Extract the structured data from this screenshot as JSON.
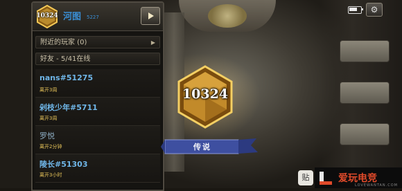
{
  "player": {
    "rank_number": "10324",
    "name": "河图",
    "tag": "5227"
  },
  "sections": {
    "nearby_players": "附近的玩家 (0)",
    "friends_header": "好友 - 5/41在线"
  },
  "friends": [
    {
      "name": "nans#51275",
      "status": "离开3周"
    },
    {
      "name": "剁枝少年#5711",
      "status": "离开3周"
    },
    {
      "name": "罗悦",
      "status": "离开2分钟"
    },
    {
      "name": "陵长#51303",
      "status": "离开3小时"
    }
  ],
  "emblem": {
    "rank_number": "10324",
    "rank_label": "传说"
  },
  "watermark": {
    "paste_label": "贴",
    "brand": "爱玩电竞",
    "sub": "LOVEWANTAN.COM"
  },
  "colors": {
    "friend_name": "#6fb6e8",
    "status": "#e8c55a",
    "player_name": "#3a8fd6",
    "banner": "#3e4fa0"
  }
}
